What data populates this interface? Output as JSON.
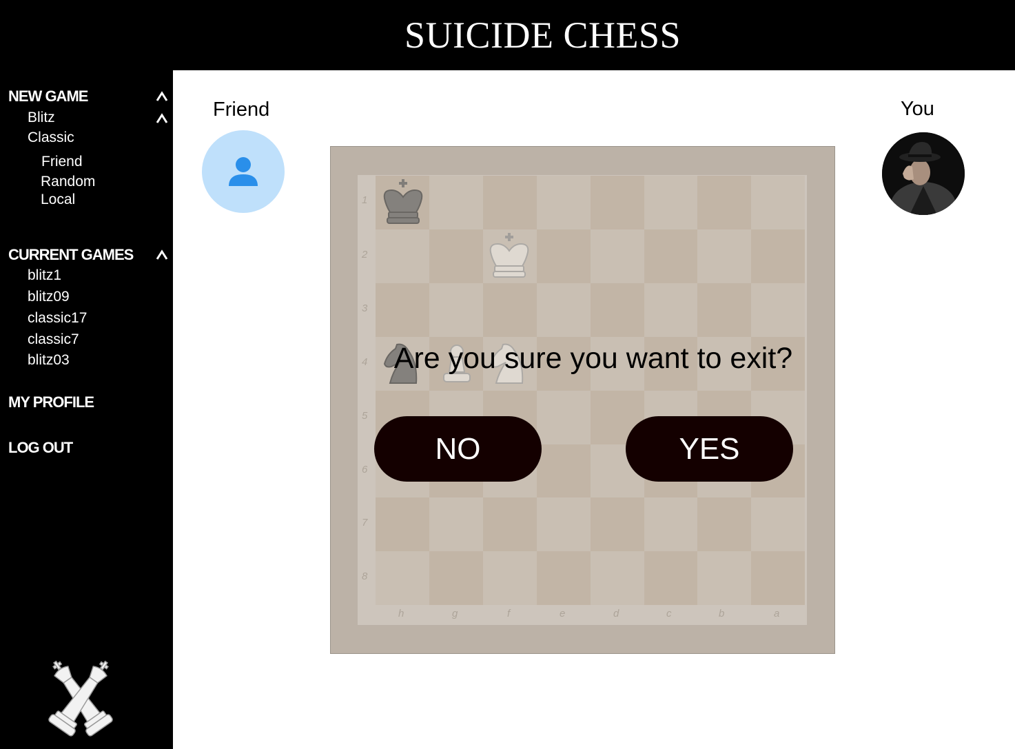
{
  "header": {
    "title": "SUICIDE CHESS"
  },
  "sidebar": {
    "new_game": {
      "label": "NEW GAME",
      "modes": [
        {
          "label": "Blitz"
        },
        {
          "label": "Classic",
          "options": [
            "Friend",
            "Random",
            "Local"
          ]
        }
      ]
    },
    "current_games": {
      "label": "CURRENT GAMES",
      "items": [
        "blitz1",
        "blitz09",
        "classic17",
        "classic7",
        "blitz03"
      ]
    },
    "my_profile": "MY PROFILE",
    "log_out": "LOG OUT",
    "logo_icon": "crossed-kings-logo"
  },
  "players": {
    "opponent": {
      "name": "Friend",
      "avatar_icon": "person-icon"
    },
    "self": {
      "name": "You",
      "avatar_icon": "detective-photo"
    }
  },
  "board": {
    "ranks": [
      "1",
      "2",
      "3",
      "4",
      "5",
      "6",
      "7",
      "8"
    ],
    "files": [
      "h",
      "g",
      "f",
      "e",
      "d",
      "c",
      "b",
      "a"
    ],
    "pieces": [
      {
        "square": "h1",
        "piece": "king",
        "color": "black"
      },
      {
        "square": "f2",
        "piece": "king",
        "color": "white"
      },
      {
        "square": "h4",
        "piece": "knight",
        "color": "black"
      },
      {
        "square": "g4",
        "piece": "pawn",
        "color": "white"
      },
      {
        "square": "f4",
        "piece": "knight",
        "color": "white"
      }
    ],
    "colors": {
      "light": "#c5bbae",
      "dark": "#bbab9a"
    }
  },
  "dialog": {
    "message": "Are you sure you want to exit?",
    "no_label": "NO",
    "yes_label": "YES"
  }
}
